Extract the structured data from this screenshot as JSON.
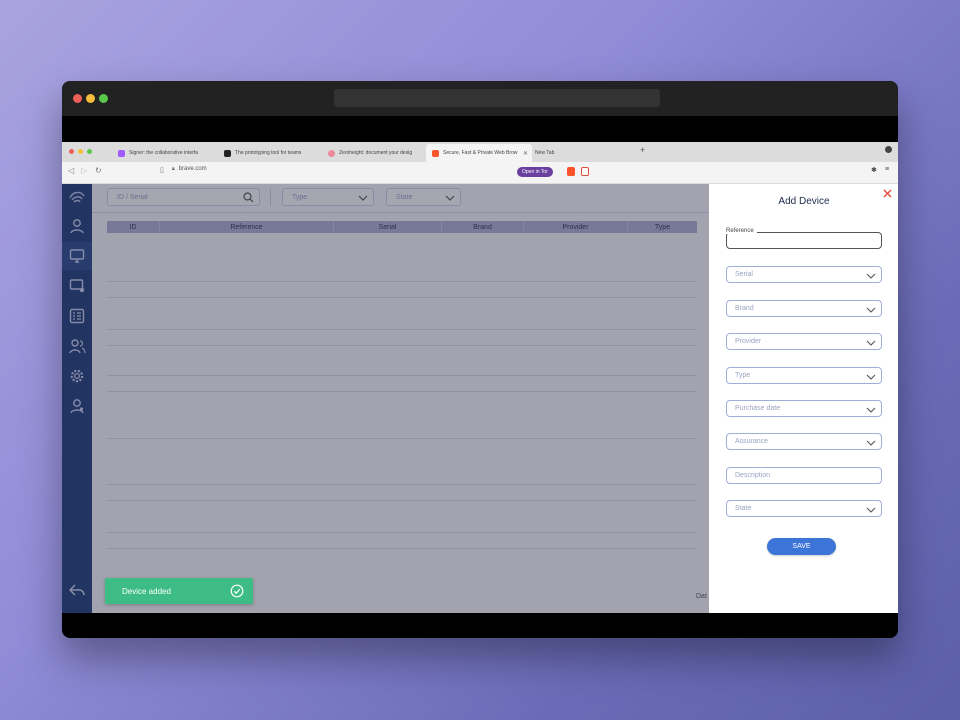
{
  "browser": {
    "tabs": [
      {
        "label": "Signer: the collaborative interfa",
        "icon_color": "#a259ff"
      },
      {
        "label": "The prototyping tool for teams",
        "icon_color": "#222222"
      },
      {
        "label": "Zeroheight: document your desig",
        "icon_color": "#e98a9a"
      },
      {
        "label": "Secure, Fast & Private Web Brow",
        "icon_color": "#fb542b"
      },
      {
        "label": "New Tab",
        "icon_color": "#cccccc"
      }
    ],
    "new_tab_symbol": "+",
    "address": "brave.com",
    "open_in_tor": "Open in Tor",
    "accent": "#6a3fa0"
  },
  "app": {
    "colors": {
      "sidebar": "#1d3c78",
      "primary": "#3d74d8",
      "success": "#3dbd85",
      "close": "#e74c3c"
    },
    "sidebar_icons": [
      "logo-icon",
      "user-icon",
      "monitor-icon",
      "device-remote-icon",
      "checklist-icon",
      "users-icon",
      "gear-icon",
      "account-icon",
      "back-icon"
    ],
    "filters": {
      "search_placeholder": "ID / Serial",
      "type_placeholder": "Type",
      "state_placeholder": "State"
    },
    "table": {
      "columns": [
        "ID",
        "Reference",
        "Serial",
        "Brand",
        "Provider",
        "Type"
      ]
    },
    "footer_label": "Dat"
  },
  "toast": {
    "message": "Device added"
  },
  "panel": {
    "title": "Add Device",
    "reference_label": "Reference",
    "reference_value": "",
    "fields": [
      {
        "placeholder": "Serial",
        "dropdown": true
      },
      {
        "placeholder": "Brand",
        "dropdown": true
      },
      {
        "placeholder": "Provider",
        "dropdown": true
      },
      {
        "placeholder": "Type",
        "dropdown": true
      },
      {
        "placeholder": "Purchase date",
        "dropdown": true
      },
      {
        "placeholder": "Assurance",
        "dropdown": true
      },
      {
        "placeholder": "Description",
        "dropdown": false
      },
      {
        "placeholder": "State",
        "dropdown": true
      }
    ],
    "save_label": "SAVE"
  }
}
